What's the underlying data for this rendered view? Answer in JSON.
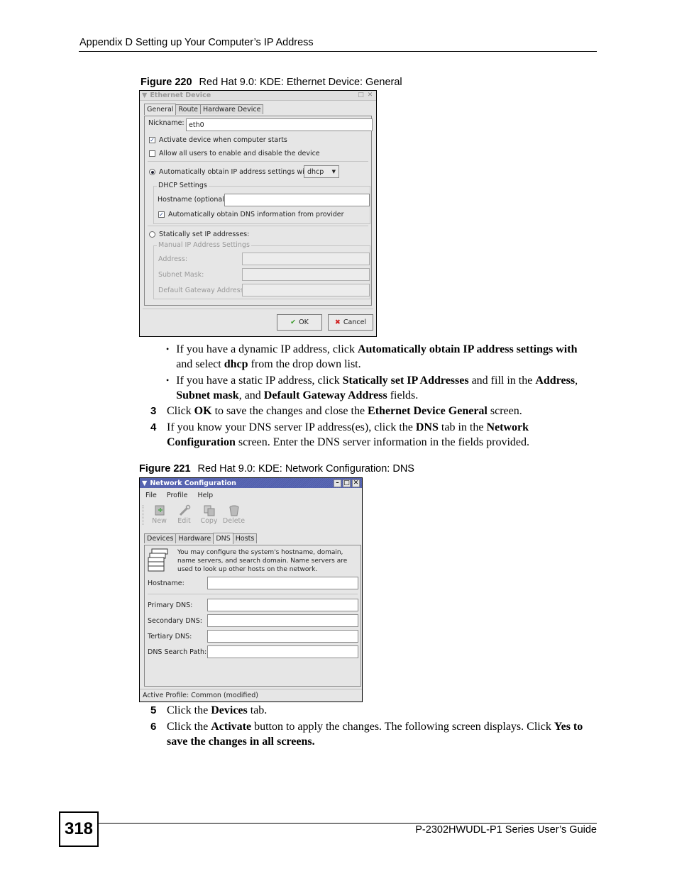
{
  "page": {
    "header": "Appendix D Setting up Your Computer’s IP Address",
    "page_number": "318",
    "footer": "P-2302HWUDL-P1 Series User’s Guide"
  },
  "figure220": {
    "label": "Figure 220",
    "caption": "Red Hat 9.0: KDE: Ethernet Device: General",
    "window": {
      "title": "Ethernet Device",
      "tabs": [
        {
          "label": "General",
          "active": true
        },
        {
          "label": "Route",
          "active": false
        },
        {
          "label": "Hardware Device",
          "active": false
        }
      ],
      "nickname_label": "Nickname:",
      "nickname_value": "eth0",
      "activate_label": "Activate device when computer starts",
      "activate_checked": true,
      "allow_users_label": "Allow all users to enable and disable the device",
      "allow_users_checked": false,
      "auto_ip_label": "Automatically obtain IP address settings with:",
      "auto_ip_selected": true,
      "auto_ip_method": "dhcp",
      "dhcp_group_title": "DHCP Settings",
      "hostname_label": "Hostname (optional):",
      "hostname_value": "",
      "auto_dns_label": "Automatically obtain DNS information from provider",
      "auto_dns_checked": true,
      "static_label": "Statically set IP addresses:",
      "static_selected": false,
      "manual_group_title": "Manual IP Address Settings",
      "address_label": "Address:",
      "subnet_label": "Subnet Mask:",
      "gateway_label": "Default Gateway Address:",
      "ok_label": "OK",
      "cancel_label": "Cancel"
    }
  },
  "instructions1": {
    "bullets": [
      {
        "parts": [
          {
            "t": "If you have a dynamic IP address, click ",
            "b": false
          },
          {
            "t": "Automatically obtain IP address settings with",
            "b": true
          },
          {
            "t": " and select ",
            "b": false
          },
          {
            "t": "dhcp",
            "b": true
          },
          {
            "t": " from the drop down list.",
            "b": false
          }
        ]
      },
      {
        "parts": [
          {
            "t": "If you have a static IP address, click ",
            "b": false
          },
          {
            "t": "Statically set IP Addresses",
            "b": true
          },
          {
            "t": " and fill in the ",
            "b": false
          },
          {
            "t": "Address",
            "b": true
          },
          {
            "t": ", ",
            "b": false
          },
          {
            "t": "Subnet mask",
            "b": true
          },
          {
            "t": ", and ",
            "b": false
          },
          {
            "t": "Default Gateway Address",
            "b": true
          },
          {
            "t": " fields.",
            "b": false
          }
        ]
      }
    ],
    "steps": [
      {
        "num": "3",
        "parts": [
          {
            "t": "Click ",
            "b": false
          },
          {
            "t": "OK",
            "b": true
          },
          {
            "t": " to save the changes and close the ",
            "b": false
          },
          {
            "t": "Ethernet Device General",
            "b": true
          },
          {
            "t": " screen.",
            "b": false
          }
        ]
      },
      {
        "num": "4",
        "parts": [
          {
            "t": "If you know your DNS server IP address(es), click the ",
            "b": false
          },
          {
            "t": "DNS",
            "b": true
          },
          {
            "t": " tab in the ",
            "b": false
          },
          {
            "t": "Network Configuration",
            "b": true
          },
          {
            "t": " screen. Enter the DNS server information in the fields provided.",
            "b": false
          }
        ]
      }
    ]
  },
  "figure221": {
    "label": "Figure 221",
    "caption": "Red Hat 9.0: KDE: Network Configuration: DNS",
    "window": {
      "title": "Network Configuration",
      "menu": [
        "File",
        "Profile",
        "Help"
      ],
      "toolbar": [
        {
          "label": "New",
          "icon": "new-device-icon"
        },
        {
          "label": "Edit",
          "icon": "wrench-icon"
        },
        {
          "label": "Copy",
          "icon": "copy-icon"
        },
        {
          "label": "Delete",
          "icon": "trash-icon"
        }
      ],
      "tabs": [
        {
          "label": "Devices",
          "active": false
        },
        {
          "label": "Hardware",
          "active": false
        },
        {
          "label": "DNS",
          "active": true
        },
        {
          "label": "Hosts",
          "active": false
        }
      ],
      "info_text": "You may configure the system's hostname, domain, name servers, and search domain. Name servers are used to look up other hosts on the network.",
      "fields": [
        {
          "label": "Hostname:",
          "value": ""
        },
        {
          "label": "Primary DNS:",
          "value": ""
        },
        {
          "label": "Secondary DNS:",
          "value": ""
        },
        {
          "label": "Tertiary DNS:",
          "value": ""
        },
        {
          "label": "DNS Search Path:",
          "value": ""
        }
      ],
      "status": "Active Profile: Common (modified)"
    }
  },
  "instructions2": {
    "steps": [
      {
        "num": "5",
        "parts": [
          {
            "t": "Click the ",
            "b": false
          },
          {
            "t": "Devices",
            "b": true
          },
          {
            "t": " tab.",
            "b": false
          }
        ]
      },
      {
        "num": "6",
        "parts": [
          {
            "t": "Click the ",
            "b": false
          },
          {
            "t": "Activate",
            "b": true
          },
          {
            "t": " button to apply the changes. The following screen displays. Click ",
            "b": false
          },
          {
            "t": "Yes to save the changes in all screens.",
            "b": true
          }
        ]
      }
    ]
  }
}
